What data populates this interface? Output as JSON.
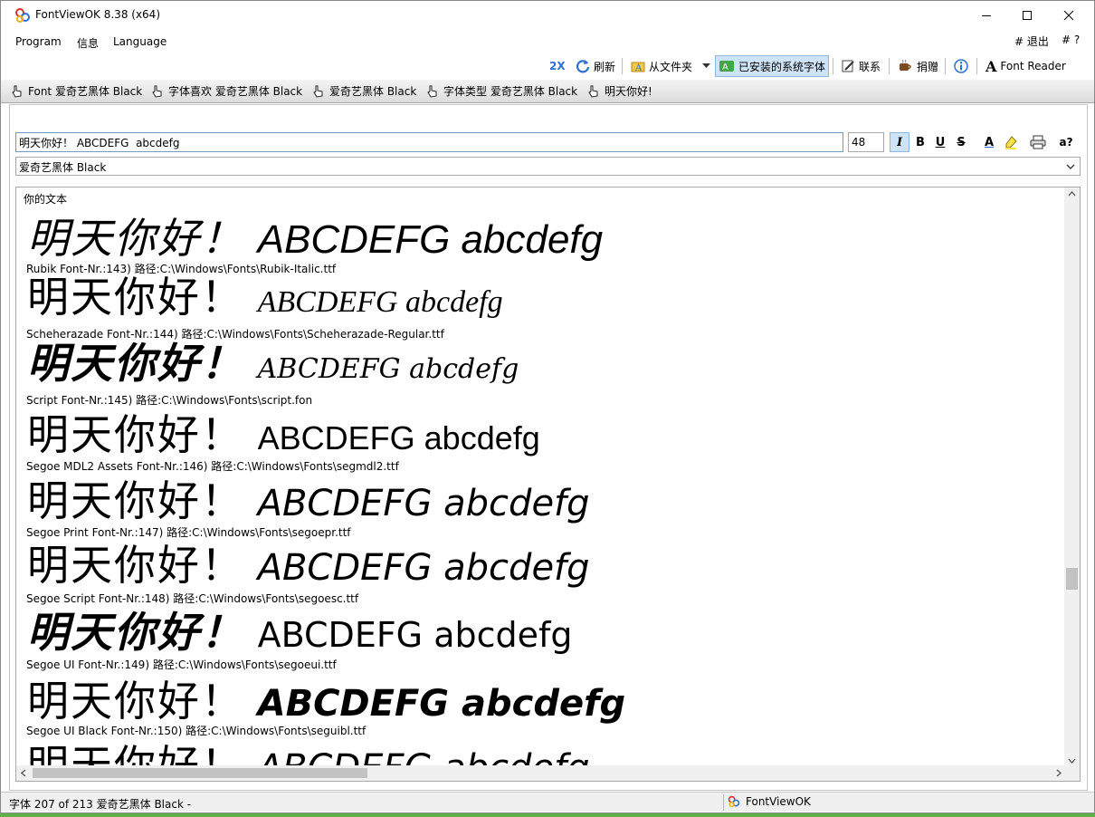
{
  "window": {
    "title": "FontViewOK 8.38  (x64)",
    "controls": {
      "minimize": "minimize",
      "maximize": "maximize",
      "close": "close"
    }
  },
  "menu": {
    "items": [
      "Program",
      "信息",
      "Language"
    ],
    "right": [
      "# 退出",
      "# ?"
    ]
  },
  "toolbar": {
    "zoom_label": "2X",
    "refresh_label": "刷新",
    "from_folder_label": "从文件夹",
    "installed_fonts_label": "已安装的系统字体",
    "contact_label": "联系",
    "donate_label": "捐赠",
    "font_reader_label": "Font Reader"
  },
  "path_bar": {
    "items": [
      "Font 爱奇艺黑体 Black",
      "字体喜欢 爱奇艺黑体 Black",
      "爱奇艺黑体 Black",
      "字体类型 爱奇艺黑体 Black",
      "明天你好!"
    ]
  },
  "editor": {
    "text_value": "明天你好！ ABCDEFG  abcdefg",
    "size_value": "48",
    "format_buttons": {
      "italic": "I",
      "bold": "B",
      "underline": "U",
      "strike": "S",
      "font_color": "A",
      "help": "a?"
    }
  },
  "font_select": {
    "selected": "爱奇艺黑体 Black"
  },
  "preview": {
    "header": "你的文本",
    "sample_cjk": "明天你好！",
    "sample_latin": "ABCDEFG  abcdefg",
    "entries": [
      {
        "caption": "Rubik Font-Nr.:143) 路径:C:\\Windows\\Fonts\\Rubik-Italic.ttf"
      },
      {
        "caption": "Scheherazade Font-Nr.:144) 路径:C:\\Windows\\Fonts\\Scheherazade-Regular.ttf"
      },
      {
        "caption": "Script Font-Nr.:145) 路径:C:\\Windows\\Fonts\\script.fon"
      },
      {
        "caption": "Segoe MDL2 Assets Font-Nr.:146) 路径:C:\\Windows\\Fonts\\segmdl2.ttf"
      },
      {
        "caption": "Segoe Print Font-Nr.:147) 路径:C:\\Windows\\Fonts\\segoepr.ttf"
      },
      {
        "caption": "Segoe Script Font-Nr.:148) 路径:C:\\Windows\\Fonts\\segoesc.ttf"
      },
      {
        "caption": "Segoe UI Font-Nr.:149) 路径:C:\\Windows\\Fonts\\segoeui.ttf"
      },
      {
        "caption": "Segoe UI Black Font-Nr.:150) 路径:C:\\Windows\\Fonts\\seguibl.ttf"
      },
      {
        "caption": ""
      }
    ]
  },
  "status": {
    "left": "字体 207 of 213 爱奇艺黑体 Black -",
    "right": "FontViewOK"
  },
  "colors": {
    "accent": "#2f6fd1",
    "active_bg": "#cfe3f7"
  }
}
